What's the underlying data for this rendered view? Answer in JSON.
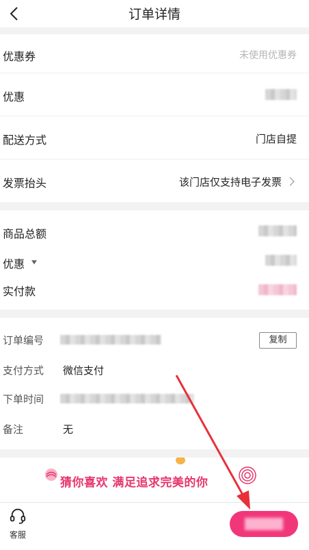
{
  "header": {
    "title": "订单详情"
  },
  "discount_rows": [
    {
      "label": "优惠券",
      "value": "未使用优惠券"
    },
    {
      "label": "优惠"
    },
    {
      "label": "配送方式",
      "value": "门店自提"
    },
    {
      "label": "发票抬头",
      "value": "该门店仅支持电子发票"
    }
  ],
  "amount_rows": [
    {
      "label": "商品总额"
    },
    {
      "label": "优惠",
      "has_dropdown": true
    },
    {
      "label": "实付款"
    }
  ],
  "info_rows": {
    "order_no_label": "订单编号",
    "copy_label": "复制",
    "pay_method_label": "支付方式",
    "pay_method_value": "微信支付",
    "order_time_label": "下单时间",
    "note_label": "备注",
    "note_value": "无"
  },
  "banner": {
    "text": "猜你喜欢 满足追求完美的你"
  },
  "bottom_bar": {
    "service_label": "客服"
  },
  "colors": {
    "accent": "#f2367a",
    "banner_text": "#e7356d",
    "annotation_arrow": "#e8303a"
  }
}
